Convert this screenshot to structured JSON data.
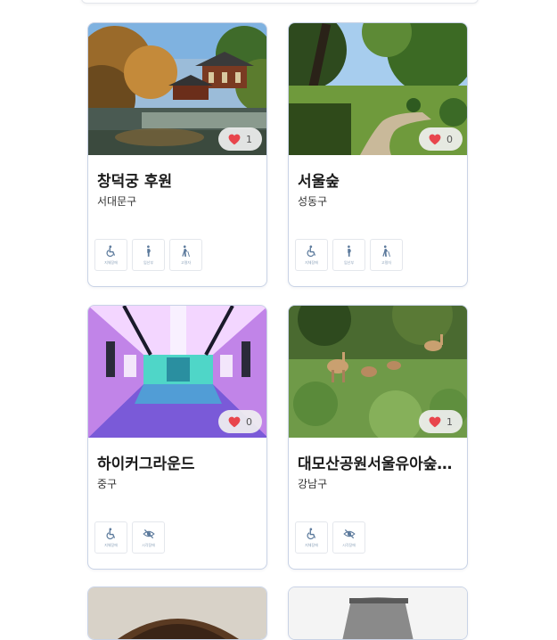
{
  "cards": [
    {
      "name": "창덕궁 후원",
      "district": "서대문구",
      "likes": "1",
      "badges": [
        {
          "icon": "wheelchair-icon",
          "label": "지체장애"
        },
        {
          "icon": "pregnant-icon",
          "label": "임산부"
        },
        {
          "icon": "elderly-icon",
          "label": "고령자"
        }
      ]
    },
    {
      "name": "서울숲",
      "district": "성동구",
      "likes": "0",
      "badges": [
        {
          "icon": "wheelchair-icon",
          "label": "지체장애"
        },
        {
          "icon": "pregnant-icon",
          "label": "임산부"
        },
        {
          "icon": "elderly-icon",
          "label": "고령자"
        }
      ]
    },
    {
      "name": "하이커그라운드",
      "district": "중구",
      "likes": "0",
      "badges": [
        {
          "icon": "wheelchair-icon",
          "label": "지체장애"
        },
        {
          "icon": "visual-impairment-icon",
          "label": "시각장애"
        }
      ]
    },
    {
      "name": "대모산공원서울유아숲체험원",
      "district": "강남구",
      "likes": "1",
      "badges": [
        {
          "icon": "wheelchair-icon",
          "label": "지체장애"
        },
        {
          "icon": "visual-impairment-icon",
          "label": "시각장애"
        }
      ]
    }
  ],
  "colors": {
    "heart": "#e8454c",
    "icon": "#5c7a9c",
    "card_border": "#c9d3e6"
  }
}
